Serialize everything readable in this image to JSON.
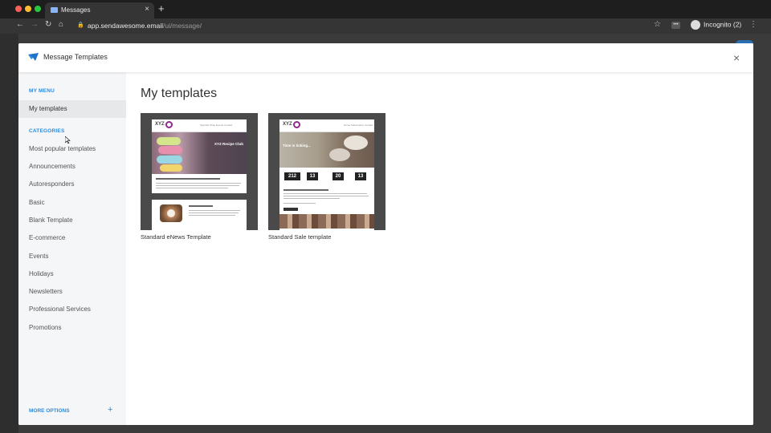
{
  "browser": {
    "tab_title": "Messages",
    "tab_close": "×",
    "new_tab": "+",
    "url_host": "app.sendawesome.email",
    "url_path": "/ui/message/",
    "incognito_label": "Incognito (2)",
    "colors": {
      "tabbar": "#1e1e1e",
      "toolbar": "#353535",
      "traffic_red": "#ff5f57",
      "traffic_yellow": "#febc2e",
      "traffic_green": "#28c840"
    }
  },
  "modal": {
    "title": "Message Templates",
    "close_glyph": "×"
  },
  "sidebar": {
    "my_menu_label": "MY MENU",
    "my_templates": "My templates",
    "categories_label": "CATEGORIES",
    "categories": [
      "Most popular templates",
      "Announcements",
      "Autoresponders",
      "Basic",
      "Blank Template",
      "E-commerce",
      "Events",
      "Holidays",
      "Newsletters",
      "Professional Services",
      "Promotions"
    ],
    "more_options": "MORE OPTIONS",
    "more_plus": "+",
    "accent_color": "#2a8be0"
  },
  "main": {
    "heading": "My templates",
    "templates": [
      {
        "name": "Standard eNews Template",
        "brand": "XYZ"
      },
      {
        "name": "Standard Sale template",
        "brand": "XYZ"
      }
    ],
    "enews_preview": {
      "hero_title": "XYZ Recipe Club",
      "countdown": [
        "212",
        "13",
        "20",
        "13"
      ]
    },
    "sale_preview": {
      "hero_text": "Time is ticking..."
    }
  }
}
